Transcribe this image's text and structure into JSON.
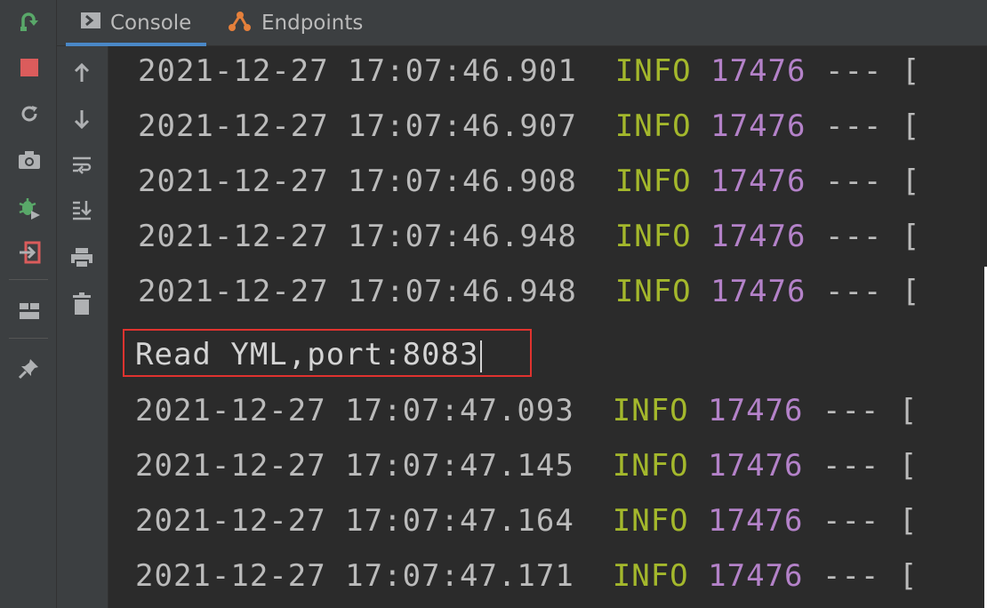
{
  "tabs": [
    {
      "label": "Console",
      "icon": "console-icon"
    },
    {
      "label": "Endpoints",
      "icon": "endpoints-icon"
    }
  ],
  "left_toolbar": [
    "rerun-icon",
    "stop-icon",
    "restore-icon",
    "screenshot-icon",
    "debug-icon",
    "exit-icon",
    "layout-icon",
    "pin-icon"
  ],
  "console_toolbar": [
    "up-arrow-icon",
    "down-arrow-icon",
    "soft-wrap-icon",
    "scroll-to-end-icon",
    "print-icon",
    "trash-icon"
  ],
  "log_lines_top": [
    {
      "timestamp": "2021-12-27 17:07:46.901",
      "level": "INFO",
      "pid": "17476",
      "sep": "---",
      "tail": "["
    },
    {
      "timestamp": "2021-12-27 17:07:46.907",
      "level": "INFO",
      "pid": "17476",
      "sep": "---",
      "tail": "["
    },
    {
      "timestamp": "2021-12-27 17:07:46.908",
      "level": "INFO",
      "pid": "17476",
      "sep": "---",
      "tail": "["
    },
    {
      "timestamp": "2021-12-27 17:07:46.948",
      "level": "INFO",
      "pid": "17476",
      "sep": "---",
      "tail": "["
    },
    {
      "timestamp": "2021-12-27 17:07:46.948",
      "level": "INFO",
      "pid": "17476",
      "sep": "---",
      "tail": "["
    }
  ],
  "highlight_line": "Read YML,port:8083",
  "log_lines_bottom": [
    {
      "timestamp": "2021-12-27 17:07:47.093",
      "level": "INFO",
      "pid": "17476",
      "sep": "---",
      "tail": "["
    },
    {
      "timestamp": "2021-12-27 17:07:47.145",
      "level": "INFO",
      "pid": "17476",
      "sep": "---",
      "tail": "["
    },
    {
      "timestamp": "2021-12-27 17:07:47.164",
      "level": "INFO",
      "pid": "17476",
      "sep": "---",
      "tail": "["
    },
    {
      "timestamp": "2021-12-27 17:07:47.171",
      "level": "INFO",
      "pid": "17476",
      "sep": "---",
      "tail": "["
    }
  ],
  "colors": {
    "info": "#a4b82c",
    "pid": "#b482c9",
    "highlight_border": "#e0332f",
    "accent": "#4a88c7"
  }
}
